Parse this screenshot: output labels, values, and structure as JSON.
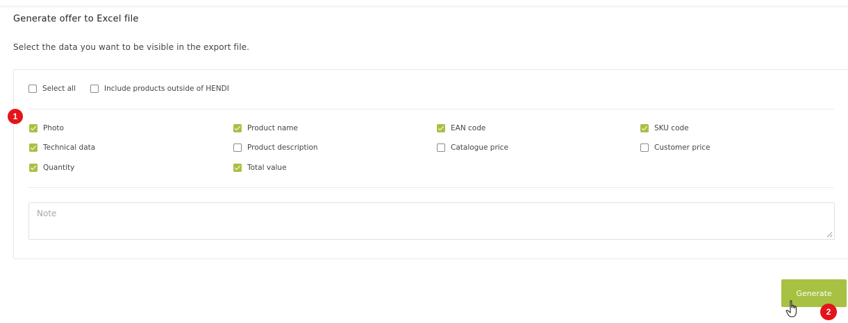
{
  "header": {
    "title": "Generate offer to Excel file",
    "subtitle": "Select the data you want to be visible in the export file."
  },
  "top_options": [
    {
      "label": "Select all",
      "checked": false
    },
    {
      "label": "Include products outside of HENDI",
      "checked": false
    }
  ],
  "fields": [
    {
      "label": "Photo",
      "checked": true
    },
    {
      "label": "Product name",
      "checked": true
    },
    {
      "label": "EAN code",
      "checked": true
    },
    {
      "label": "SKU code",
      "checked": true
    },
    {
      "label": "Technical data",
      "checked": true
    },
    {
      "label": "Product description",
      "checked": false
    },
    {
      "label": "Catalogue price",
      "checked": false
    },
    {
      "label": "Customer price",
      "checked": false
    },
    {
      "label": "Quantity",
      "checked": true
    },
    {
      "label": "Total value",
      "checked": true
    }
  ],
  "note": {
    "placeholder": "Note",
    "value": ""
  },
  "generate_button": {
    "label": "Generate"
  },
  "annotations": {
    "step1": "1",
    "step2": "2"
  },
  "colors": {
    "accent": "#a7c142",
    "badge": "#e3141b"
  },
  "icons": {
    "cursor": "hand-pointer-icon",
    "resize": "resize-grip-icon"
  }
}
